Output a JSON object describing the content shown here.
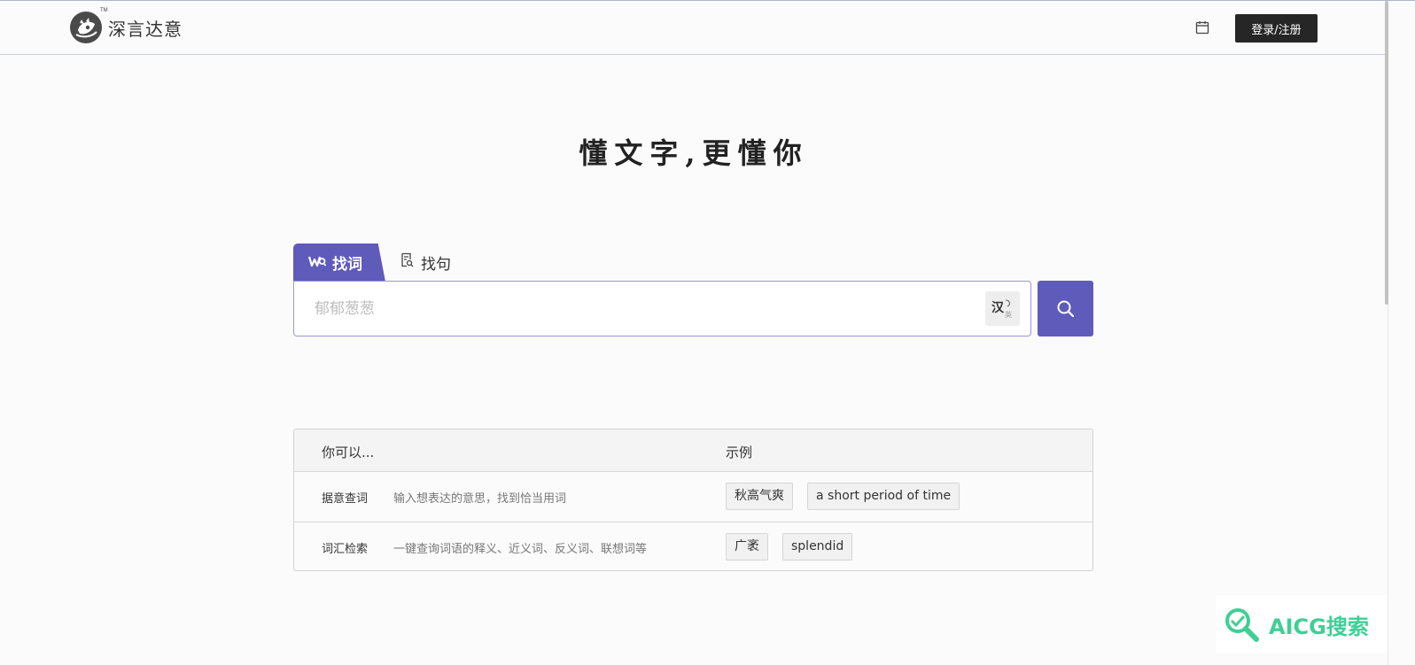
{
  "header": {
    "brand": "深言达意",
    "brand_tm": "TM",
    "calendar_icon": "calendar-icon",
    "login_label": "登录/注册"
  },
  "hero": {
    "slogan": "懂文字,更懂你"
  },
  "search": {
    "tabs": [
      {
        "label": "找词",
        "icon": "word-search-icon",
        "active": true
      },
      {
        "label": "找句",
        "icon": "sentence-search-icon",
        "active": false
      }
    ],
    "placeholder": "郁郁葱葱",
    "lang_toggle_main": "汉",
    "lang_toggle_sub": "英",
    "search_icon": "search-icon"
  },
  "guide": {
    "col_can": "你可以...",
    "col_example": "示例",
    "rows": [
      {
        "name": "据意查词",
        "desc": "输入想表达的意思，找到恰当用词",
        "examples": [
          "秋高气爽",
          "a short period of time"
        ]
      },
      {
        "name": "词汇检索",
        "desc": "一键查询词语的释义、近义词、反义词、联想词等",
        "examples": [
          "广袤",
          "splendid"
        ]
      }
    ]
  },
  "watermark": {
    "text": "AICG搜索"
  },
  "colors": {
    "accent": "#5f5bbb",
    "login_bg": "#262626",
    "watermark": "#3fcf95"
  }
}
